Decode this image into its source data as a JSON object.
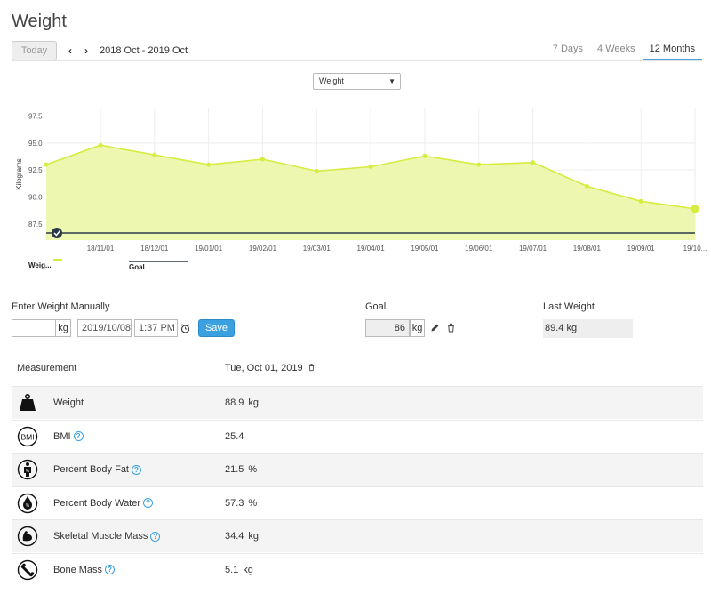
{
  "page": {
    "title": "Weight"
  },
  "nav": {
    "today_label": "Today",
    "prev_icon": "chevron-left-icon",
    "next_icon": "chevron-right-icon",
    "date_range": "2018 Oct - 2019 Oct",
    "tabs": [
      {
        "label": "7 Days",
        "active": false
      },
      {
        "label": "4 Weeks",
        "active": false
      },
      {
        "label": "12 Months",
        "active": true
      }
    ]
  },
  "metric_select": {
    "selected": "Weight"
  },
  "chart_data": {
    "type": "area",
    "ylabel": "Kilograms",
    "yticks": [
      87.5,
      90.0,
      92.5,
      95.0,
      97.5
    ],
    "ytick_labels": [
      "87.5",
      "90.0",
      "92.5",
      "95.0",
      "97.5"
    ],
    "ylim": [
      86,
      98.2
    ],
    "categories": [
      "18/11/01",
      "18/12/01",
      "19/01/01",
      "19/02/01",
      "19/03/01",
      "19/04/01",
      "19/05/01",
      "19/06/01",
      "19/07/01",
      "19/08/01",
      "19/09/01",
      "19/10..."
    ],
    "series": [
      {
        "name": "Weig...",
        "color": "#d6ec3f",
        "values": [
          93.0,
          94.8,
          93.9,
          93.0,
          93.5,
          92.4,
          92.8,
          93.8,
          93.0,
          93.2,
          91.0,
          89.6,
          88.9
        ]
      },
      {
        "name": "Goal",
        "color": "#2b3a48",
        "values": [
          86,
          86
        ]
      }
    ],
    "grid": true,
    "legend": "bottom-left"
  },
  "entry": {
    "label": "Enter Weight Manually",
    "kg_value": "",
    "unit": "kg",
    "date": "2019/10/08",
    "time": "1:37 PM",
    "save_label": "Save"
  },
  "goal": {
    "label": "Goal",
    "value": "86",
    "unit": "kg"
  },
  "last_weight": {
    "label": "Last Weight",
    "value": "89.4 kg"
  },
  "table": {
    "col_measurement": "Measurement",
    "col_date": "Tue, Oct 01, 2019",
    "rows": [
      {
        "name": "Weight",
        "value": "88.9",
        "unit": "kg",
        "help": false,
        "icon": "weight-icon"
      },
      {
        "name": "BMI",
        "value": "25.4",
        "unit": "",
        "help": true,
        "icon": "bmi-icon"
      },
      {
        "name": "Percent Body Fat",
        "value": "21.5",
        "unit": "%",
        "help": true,
        "icon": "body-fat-icon"
      },
      {
        "name": "Percent Body Water",
        "value": "57.3",
        "unit": "%",
        "help": true,
        "icon": "body-water-icon"
      },
      {
        "name": "Skeletal Muscle Mass",
        "value": "34.4",
        "unit": "kg",
        "help": true,
        "icon": "muscle-icon"
      },
      {
        "name": "Bone Mass",
        "value": "5.1",
        "unit": "kg",
        "help": true,
        "icon": "bone-icon"
      }
    ]
  }
}
